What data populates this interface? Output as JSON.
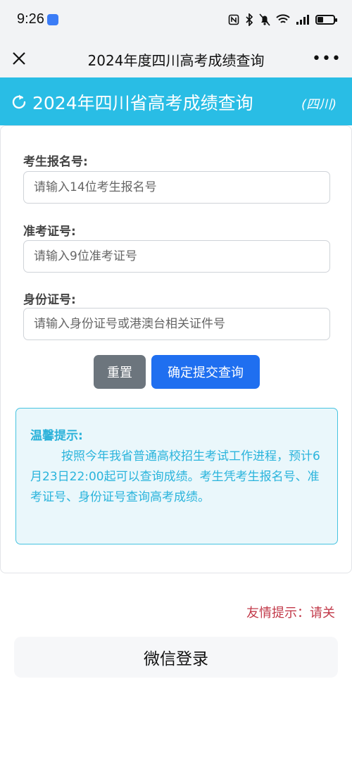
{
  "status_bar": {
    "time": "9:26",
    "icons": [
      "nfc-icon",
      "bluetooth-icon",
      "mute-icon",
      "wifi-icon",
      "signal-icon",
      "battery-icon"
    ],
    "battery_level": 0.35
  },
  "title_bar": {
    "title": "2024年度四川高考成绩查询",
    "close_icon": "close-icon",
    "more_icon": "more-icon"
  },
  "header": {
    "title": "2024年四川省高考成绩查询",
    "region": "(四川)",
    "background": "#29bde5"
  },
  "form": {
    "fields": [
      {
        "label": "考生报名号:",
        "placeholder": "请输入14位考生报名号"
      },
      {
        "label": "准考证号:",
        "placeholder": "请输入9位准考证号"
      },
      {
        "label": "身份证号:",
        "placeholder": "请输入身份证号或港澳台相关证件号"
      }
    ],
    "reset_label": "重置",
    "submit_label": "确定提交查询"
  },
  "notice": {
    "title": "温馨提示:",
    "body": "按照今年我省普通高校招生考试工作进程，预计6月23日22:00起可以查询成绩。考生凭考生报名号、准考证号、身份证号查询高考成绩。"
  },
  "ticker": {
    "text": "友情提示：请关"
  },
  "wechat_login": {
    "label": "微信登录"
  },
  "colors": {
    "accent": "#29bde5",
    "submit": "#1f6ff0",
    "reset": "#6c757d",
    "notice_text": "#2ab4dc",
    "ticker_text": "#c23a4a"
  }
}
